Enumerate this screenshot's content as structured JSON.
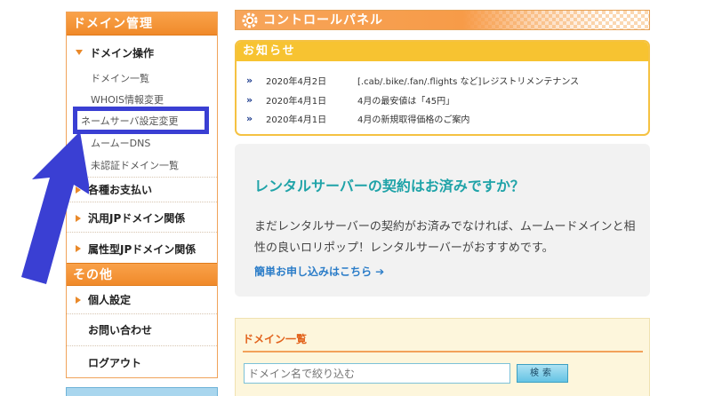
{
  "sidebar": {
    "domain_header": "ドメイン管理",
    "domain_ops": "ドメイン操作",
    "sub_items": [
      "ドメイン一覧",
      "WHOIS情報変更",
      "ネームサーバ設定変更",
      "ムームーDNS",
      "未認証ドメイン一覧"
    ],
    "payments": "各種お支払い",
    "jp_generic": "汎用JPドメイン関係",
    "jp_attr": "属性型JPドメイン関係",
    "other_header": "その他",
    "personal": "個人設定",
    "contact": "お問い合わせ",
    "logout": "ログアウト"
  },
  "control_panel": {
    "title": "コントロールパネル"
  },
  "news": {
    "title": "お知らせ",
    "items": [
      {
        "date": "2020年4月2日",
        "text": "[.cab/.bike/.fan/.flights など]レジストリメンテナンス"
      },
      {
        "date": "2020年4月1日",
        "text": "4月の最安値は「45円」"
      },
      {
        "date": "2020年4月1日",
        "text": "4月の新規取得価格のご案内"
      }
    ]
  },
  "rental": {
    "title": "レンタルサーバーの契約はお済みですか？",
    "body": "まだレンタルサーバーの契約がお済みでなければ、ムームードメインと相性の良いロリポップ！レンタルサーバーがおすすめです。",
    "link": "簡単お申し込みはこちら ➔"
  },
  "domain_list": {
    "title": "ドメイン一覧",
    "search_placeholder": "ドメイン名で絞り込む",
    "search_button": "検索"
  },
  "colors": {
    "accent_orange": "#f08a2a",
    "news_yellow": "#f7c331",
    "rental_teal": "#1fa3a8",
    "annotation_blue": "#3a3fd3"
  }
}
